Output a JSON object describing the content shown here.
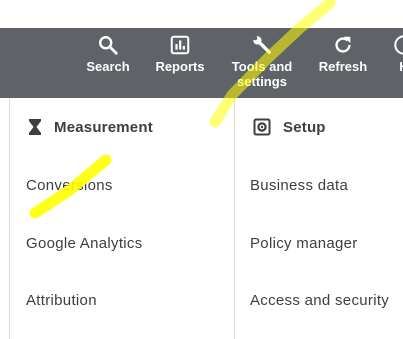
{
  "toolbar": {
    "items": [
      {
        "label": "Search",
        "icon": "search-icon"
      },
      {
        "label": "Reports",
        "icon": "reports-icon"
      },
      {
        "label": "Tools and settings",
        "icon": "wrench-icon"
      },
      {
        "label": "Refresh",
        "icon": "refresh-icon"
      },
      {
        "label": "H",
        "icon": "help-icon"
      }
    ]
  },
  "measurement": {
    "title": "Measurement",
    "icon": "hourglass-icon",
    "items": [
      "Conversions",
      "Google Analytics",
      "Attribution"
    ]
  },
  "setup": {
    "title": "Setup",
    "icon": "gear-box-icon",
    "items": [
      "Business data",
      "Policy manager",
      "Access and security"
    ]
  },
  "colors": {
    "toolbar_bg": "#5f6368",
    "highlight": "#ffff00",
    "text": "#3c4043"
  }
}
